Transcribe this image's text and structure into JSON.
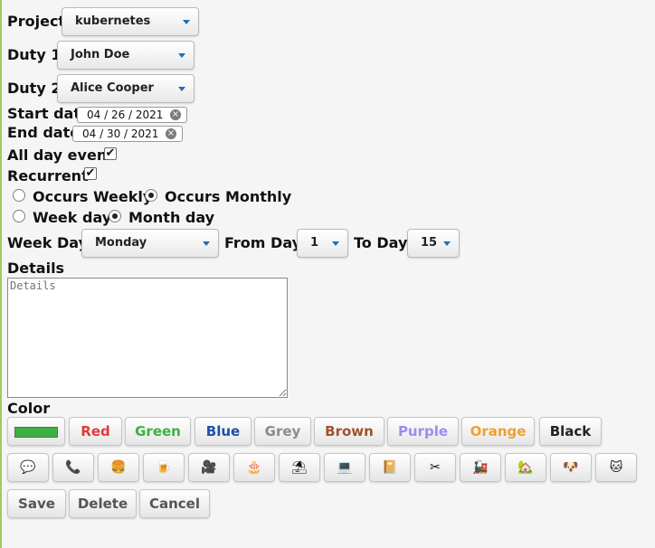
{
  "labels": {
    "project": "Project",
    "duty1": "Duty 1",
    "duty2": "Duty 2",
    "start_date": "Start date",
    "end_date": "End date",
    "all_day": "All day event",
    "recurrent": "Recurrent",
    "week_day": "Week Day",
    "from_day": "From Day",
    "to_day": "To Day",
    "details": "Details",
    "color": "Color"
  },
  "selects": {
    "project": "kubernetes",
    "duty1": "John Doe",
    "duty2": "Alice Cooper",
    "week_day": "Monday",
    "from_day": "1",
    "to_day": "15"
  },
  "dates": {
    "start": "04 / 26 / 2021",
    "end": "04 / 30 / 2021"
  },
  "checkboxes": {
    "all_day": true,
    "recurrent": true
  },
  "radios": {
    "occurs_weekly": "Occurs Weekly",
    "occurs_monthly": "Occurs Monthly",
    "week_day": "Week day",
    "month_day": "Month day"
  },
  "details_placeholder": "Details",
  "color_buttons": [
    {
      "label": "",
      "color": "#3cb043"
    },
    {
      "label": "Red",
      "color": "#e53935"
    },
    {
      "label": "Green",
      "color": "#3cb043"
    },
    {
      "label": "Blue",
      "color": "#1e4fa8"
    },
    {
      "label": "Grey",
      "color": "#8a8a8a"
    },
    {
      "label": "Brown",
      "color": "#a0522d"
    },
    {
      "label": "Purple",
      "color": "#9b8cf0"
    },
    {
      "label": "Orange",
      "color": "#f0a030"
    },
    {
      "label": "Black",
      "color": "#222222"
    }
  ],
  "icon_buttons": [
    {
      "icon": "speech-bubble-icon",
      "glyph": "💬"
    },
    {
      "icon": "phone-icon",
      "glyph": "📞"
    },
    {
      "icon": "burger-icon",
      "glyph": "🍔"
    },
    {
      "icon": "beer-icon",
      "glyph": "🍺"
    },
    {
      "icon": "movie-camera-icon",
      "glyph": "🎥"
    },
    {
      "icon": "cake-icon",
      "glyph": "🎂"
    },
    {
      "icon": "beach-umbrella-icon",
      "glyph": "⛱"
    },
    {
      "icon": "laptop-icon",
      "glyph": "💻"
    },
    {
      "icon": "notebook-icon",
      "glyph": "📔"
    },
    {
      "icon": "scissors-icon",
      "glyph": "✂"
    },
    {
      "icon": "train-icon",
      "glyph": "🚂"
    },
    {
      "icon": "house-icon",
      "glyph": "🏡"
    },
    {
      "icon": "dog-icon",
      "glyph": "🐶"
    },
    {
      "icon": "cat-icon",
      "glyph": "🐱"
    }
  ],
  "actions": {
    "save": "Save",
    "delete": "Delete",
    "cancel": "Cancel"
  }
}
